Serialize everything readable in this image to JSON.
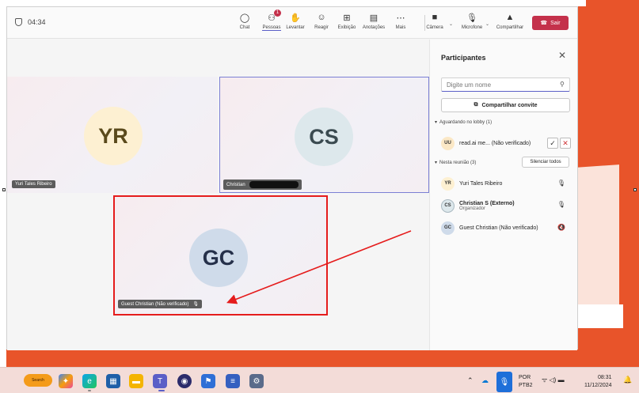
{
  "meeting": {
    "timer": "04:34",
    "toolbar": [
      {
        "label": "Chat",
        "icon": "chat-icon",
        "glyph": "☺"
      },
      {
        "label": "Pessoas",
        "icon": "people-icon",
        "glyph": "👥",
        "badge": "1",
        "active": true
      },
      {
        "label": "Levantar",
        "icon": "raise-hand-icon",
        "glyph": "✋"
      },
      {
        "label": "Reagir",
        "icon": "react-icon",
        "glyph": "☺"
      },
      {
        "label": "Exibição",
        "icon": "view-icon",
        "glyph": "⊞"
      },
      {
        "label": "Anotações",
        "icon": "notes-icon",
        "glyph": "▤"
      },
      {
        "label": "Mais",
        "icon": "more-icon",
        "glyph": "⋯"
      },
      {
        "label": "Câmera",
        "icon": "camera-off-icon",
        "glyph": "■"
      },
      {
        "label": "Microfone",
        "icon": "microphone-icon",
        "glyph": "🎙"
      },
      {
        "label": "Compartilhar",
        "icon": "share-icon",
        "glyph": "▲"
      }
    ],
    "leave_label": "Sair"
  },
  "tiles": [
    {
      "initials": "YR",
      "name": "Yuri Tales Ribeiro",
      "avatar_color": "#fdf0d2"
    },
    {
      "initials": "CS",
      "name": "Christian",
      "avatar_color": "#dde8ec"
    },
    {
      "initials": "GC",
      "name": "Guest Christian (Não verificado)",
      "avatar_color": "#cfdbea"
    }
  ],
  "panel": {
    "title": "Participantes",
    "search_placeholder": "Digite um nome",
    "share_invite": "Compartilhar convite",
    "lobby_label": "Aguardando no lobby (1)",
    "lobby": [
      {
        "initials": "UU",
        "name": "read.ai me... (Não verificado)",
        "avatar_color": "#fbe8c6"
      }
    ],
    "in_meeting_label": "Nesta reunião (3)",
    "mute_all": "Silenciar todos",
    "participants": [
      {
        "initials": "YR",
        "name": "Yuri Tales Ribeiro",
        "sub": "",
        "avatar_color": "#fdf0d2"
      },
      {
        "initials": "CS",
        "name": "Christian S (Externo)",
        "sub": "Organizador",
        "avatar_color": "#dde8ec"
      },
      {
        "initials": "GC",
        "name": "Guest Christian (Não verificado)",
        "sub": "",
        "avatar_color": "#cfdbea"
      }
    ]
  },
  "taskbar": {
    "search_pill": "Search",
    "lang": "POR",
    "layout": "PTB2",
    "time": "08:31",
    "date": "11/12/2024"
  }
}
